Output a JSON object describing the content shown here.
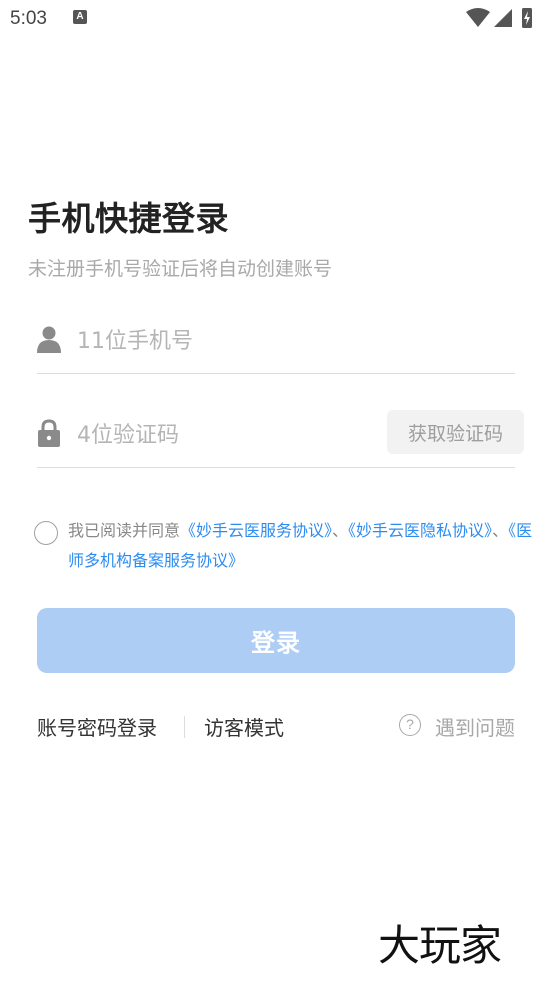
{
  "status_bar": {
    "time": "5:03",
    "notification_icon": "A"
  },
  "page": {
    "title": "手机快捷登录",
    "subtitle": "未注册手机号验证后将自动创建账号"
  },
  "phone_field": {
    "placeholder": "11位手机号",
    "icon": "user-icon"
  },
  "code_field": {
    "placeholder": "4位验证码",
    "icon": "lock-icon",
    "get_code_label": "获取验证码"
  },
  "agreement": {
    "prefix": "我已阅读并同意",
    "link1": "《妙手云医服务协议》",
    "sep1": "、",
    "link2": "《妙手云医隐私协议》",
    "sep2": "、",
    "link3": "《医师多机构备案服务协议》"
  },
  "login_button": {
    "label": "登录"
  },
  "bottom_links": {
    "password_login": "账号密码登录",
    "visitor_mode": "访客模式",
    "help_icon_glyph": "?",
    "help": "遇到问题"
  },
  "watermark": {
    "text": "大玩家"
  },
  "colors": {
    "accent": "#2d8cf0",
    "button_disabled": "#adcdf5"
  }
}
